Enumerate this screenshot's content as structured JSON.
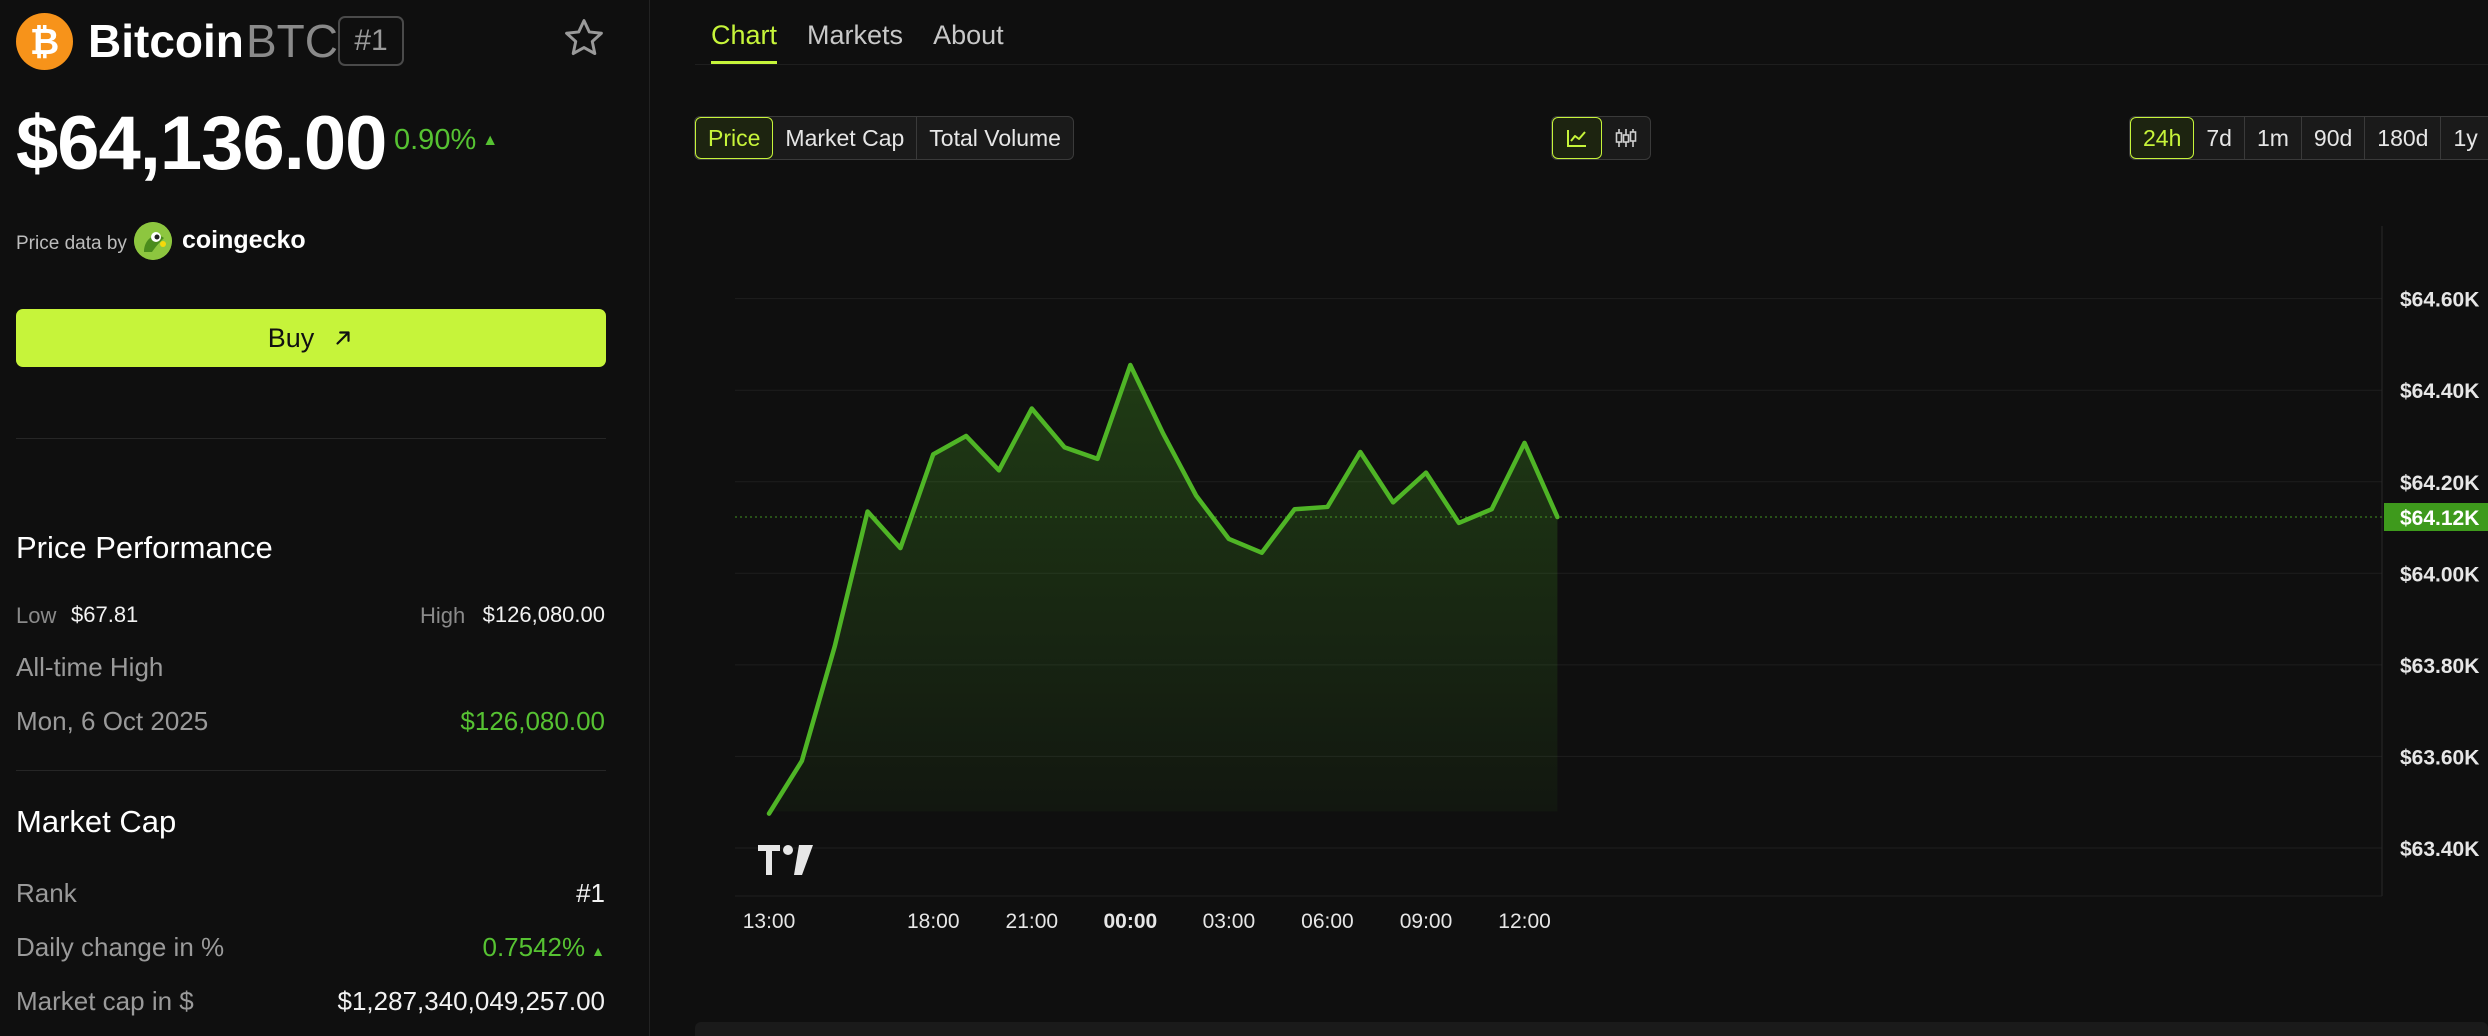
{
  "coin": {
    "name": "Bitcoin",
    "symbol": "BTC",
    "rank": "#1",
    "logo_glyph": "₿",
    "price": "$64,136.00",
    "change": "0.90%",
    "change_dir": "▲"
  },
  "price_data": {
    "label": "Price data by",
    "provider": "coingecko"
  },
  "buy": {
    "label": "Buy",
    "icon": "arrow-up-right-icon"
  },
  "performance": {
    "title": "Price Performance",
    "low_label": "Low",
    "low_value": "$67.81",
    "high_label": "High",
    "high_value": "$126,080.00",
    "ath_label": "All-time High",
    "ath_date": "Mon, 6 Oct 2025",
    "ath_value": "$126,080.00"
  },
  "market_cap": {
    "title": "Market Cap",
    "rank_label": "Rank",
    "rank_value": "#1",
    "daily_label": "Daily change in %",
    "daily_value": "0.7542%",
    "daily_dir": "▲",
    "cap_label": "Market cap in $",
    "cap_value": "$1,287,340,049,257.00"
  },
  "tabs": [
    {
      "label": "Chart",
      "active": true
    },
    {
      "label": "Markets",
      "active": false
    },
    {
      "label": "About",
      "active": false
    }
  ],
  "metric_buttons": [
    {
      "label": "Price",
      "active": true
    },
    {
      "label": "Market Cap",
      "active": false
    },
    {
      "label": "Total Volume",
      "active": false
    }
  ],
  "chart_type_buttons": [
    {
      "icon": "line-chart-icon",
      "active": true
    },
    {
      "icon": "candlestick-icon",
      "active": false
    }
  ],
  "range_buttons": [
    {
      "label": "24h",
      "active": true
    },
    {
      "label": "7d",
      "active": false
    },
    {
      "label": "1m",
      "active": false
    },
    {
      "label": "90d",
      "active": false
    },
    {
      "label": "180d",
      "active": false
    },
    {
      "label": "1y",
      "active": false
    }
  ],
  "colors": {
    "accent": "#c6f43a",
    "line": "#4fb526",
    "up": "#56c232",
    "bg": "#0f0f0f"
  },
  "chart_data": {
    "type": "area",
    "x_ticks": [
      "13:00",
      "18:00",
      "21:00",
      "00:00",
      "03:00",
      "06:00",
      "09:00",
      "12:00"
    ],
    "y_ticks": [
      "$64.60K",
      "$64.40K",
      "$64.20K",
      "$64.00K",
      "$63.80K",
      "$63.60K",
      "$63.40K"
    ],
    "y_tick_values": [
      64600,
      64400,
      64200,
      64000,
      63800,
      63600,
      63400
    ],
    "ylim": [
      63330,
      64750
    ],
    "current_label": "$64.12K",
    "current_value": 64123,
    "grid": true,
    "series": [
      {
        "values": [
          {
            "x": "13:00",
            "y": 63475
          },
          {
            "x": "14:00",
            "y": 63590
          },
          {
            "x": "15:00",
            "y": 63840
          },
          {
            "x": "16:00",
            "y": 64135
          },
          {
            "x": "17:00",
            "y": 64055
          },
          {
            "x": "18:00",
            "y": 64260
          },
          {
            "x": "19:00",
            "y": 64300
          },
          {
            "x": "20:00",
            "y": 64225
          },
          {
            "x": "21:00",
            "y": 64360
          },
          {
            "x": "22:00",
            "y": 64275
          },
          {
            "x": "23:00",
            "y": 64250
          },
          {
            "x": "00:00",
            "y": 64455
          },
          {
            "x": "01:00",
            "y": 64305
          },
          {
            "x": "02:00",
            "y": 64170
          },
          {
            "x": "03:00",
            "y": 64075
          },
          {
            "x": "04:00",
            "y": 64045
          },
          {
            "x": "05:00",
            "y": 64140
          },
          {
            "x": "06:00",
            "y": 64145
          },
          {
            "x": "07:00",
            "y": 64265
          },
          {
            "x": "08:00",
            "y": 64155
          },
          {
            "x": "09:00",
            "y": 64220
          },
          {
            "x": "10:00",
            "y": 64110
          },
          {
            "x": "11:00",
            "y": 64140
          },
          {
            "x": "12:00",
            "y": 64285
          },
          {
            "x": "13:00",
            "y": 64123
          }
        ]
      }
    ]
  }
}
